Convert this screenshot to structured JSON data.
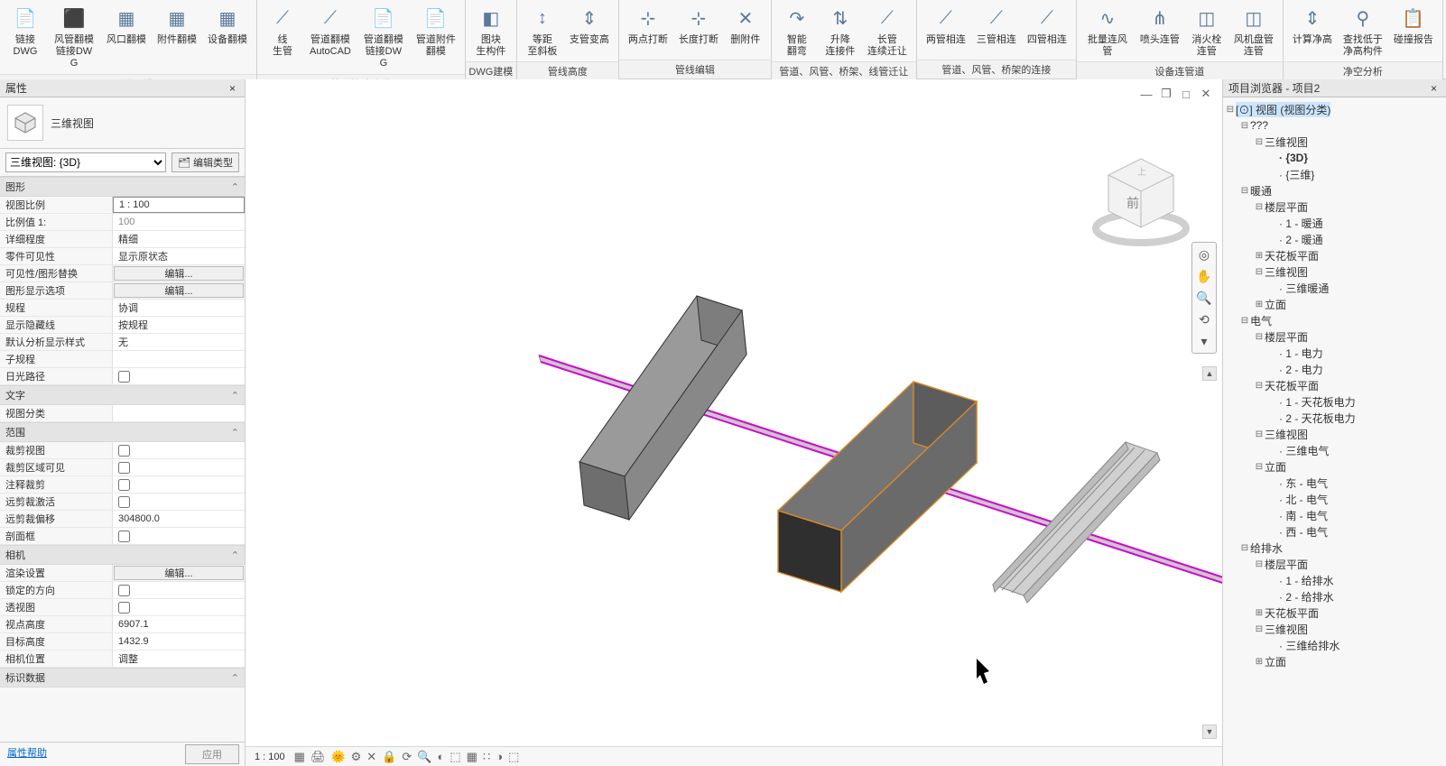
{
  "ribbon": {
    "groups": [
      {
        "title": "风系统翻模",
        "buttons": [
          {
            "label": "链接\nDWG",
            "icon": "📄"
          },
          {
            "label": "风管翻模\n链接DWG",
            "icon": "⬛"
          },
          {
            "label": "风口翻模",
            "icon": "▦"
          },
          {
            "label": "附件翻模",
            "icon": "▦"
          },
          {
            "label": "设备翻模",
            "icon": "▦"
          }
        ]
      },
      {
        "title": "管道快速建模",
        "buttons": [
          {
            "label": "线\n生管",
            "icon": "⟋"
          },
          {
            "label": "管道翻模\nAutoCAD",
            "icon": "⟋"
          },
          {
            "label": "管道翻模\n链接DWG",
            "icon": "📄"
          },
          {
            "label": "管道附件\n翻模",
            "icon": "📄"
          }
        ]
      },
      {
        "title": "DWG建模",
        "buttons": [
          {
            "label": "图块\n生构件",
            "icon": "◧"
          }
        ]
      },
      {
        "title": "管线高度",
        "buttons": [
          {
            "label": "等距\n至斜板",
            "icon": "↕"
          },
          {
            "label": "支管变高",
            "icon": "⇕"
          }
        ]
      },
      {
        "title": "管线编辑",
        "buttons": [
          {
            "label": "两点打断",
            "icon": "⊹"
          },
          {
            "label": "长度打断",
            "icon": "⊹"
          },
          {
            "label": "删附件",
            "icon": "✕"
          }
        ]
      },
      {
        "title": "管道、风管、桥架、线管迁让",
        "buttons": [
          {
            "label": "智能\n翻弯",
            "icon": "↷"
          },
          {
            "label": "升降\n连接件",
            "icon": "⇅"
          },
          {
            "label": "长管\n连续迁让",
            "icon": "⟋"
          }
        ]
      },
      {
        "title": "管道、风管、桥架的连接",
        "buttons": [
          {
            "label": "两管相连",
            "icon": "⟋"
          },
          {
            "label": "三管相连",
            "icon": "⟋"
          },
          {
            "label": "四管相连",
            "icon": "⟋"
          }
        ]
      },
      {
        "title": "设备连管道",
        "buttons": [
          {
            "label": "批量连风管",
            "icon": "∿"
          },
          {
            "label": "喷头连管",
            "icon": "⋔"
          },
          {
            "label": "消火栓\n连管",
            "icon": "◫"
          },
          {
            "label": "风机盘管\n连管",
            "icon": "◫"
          }
        ]
      },
      {
        "title": "净空分析",
        "buttons": [
          {
            "label": "计算净高",
            "icon": "⇕"
          },
          {
            "label": "查找低于\n净高构件",
            "icon": "⚲"
          },
          {
            "label": "碰撞报告",
            "icon": "📋"
          }
        ]
      }
    ]
  },
  "properties": {
    "title": "属性",
    "typeLabel": "三维视图",
    "selector": "三维视图: {3D}",
    "editTypeLabel": "编辑类型",
    "groups": [
      {
        "name": "图形",
        "rows": [
          {
            "n": "视图比例",
            "v": "1 : 100",
            "boxed": true
          },
          {
            "n": "比例值 1:",
            "v": "100",
            "grey": true
          },
          {
            "n": "详细程度",
            "v": "精细"
          },
          {
            "n": "零件可见性",
            "v": "显示原状态"
          },
          {
            "n": "可见性/图形替换",
            "v": "编辑...",
            "btn": true
          },
          {
            "n": "图形显示选项",
            "v": "编辑...",
            "btn": true
          },
          {
            "n": "规程",
            "v": "协调"
          },
          {
            "n": "显示隐藏线",
            "v": "按规程"
          },
          {
            "n": "默认分析显示样式",
            "v": "无"
          },
          {
            "n": "子规程",
            "v": ""
          },
          {
            "n": "日光路径",
            "v": "",
            "check": false
          }
        ]
      },
      {
        "name": "文字",
        "rows": [
          {
            "n": "视图分类",
            "v": ""
          }
        ]
      },
      {
        "name": "范围",
        "rows": [
          {
            "n": "裁剪视图",
            "v": "",
            "check": false
          },
          {
            "n": "裁剪区域可见",
            "v": "",
            "check": false
          },
          {
            "n": "注释裁剪",
            "v": "",
            "check": false
          },
          {
            "n": "远剪裁激活",
            "v": "",
            "check": false
          },
          {
            "n": "远剪裁偏移",
            "v": "304800.0"
          },
          {
            "n": "剖面框",
            "v": "",
            "check": false
          }
        ]
      },
      {
        "name": "相机",
        "rows": [
          {
            "n": "渲染设置",
            "v": "编辑...",
            "btn": true
          },
          {
            "n": "锁定的方向",
            "v": "",
            "check": false
          },
          {
            "n": "透视图",
            "v": "",
            "check": false
          },
          {
            "n": "视点高度",
            "v": "6907.1"
          },
          {
            "n": "目标高度",
            "v": "1432.9"
          },
          {
            "n": "相机位置",
            "v": "调整"
          }
        ]
      },
      {
        "name": "标识数据",
        "rows": []
      }
    ],
    "helpLink": "属性帮助",
    "applyLabel": "应用"
  },
  "browser": {
    "title": "项目浏览器 - 项目2",
    "tree": [
      {
        "depth": 0,
        "toggle": "-",
        "label": "视图 (视图分类)",
        "highlight": true,
        "icon": "[⊙]"
      },
      {
        "depth": 1,
        "toggle": "-",
        "label": "???"
      },
      {
        "depth": 2,
        "toggle": "-",
        "label": "三维视图"
      },
      {
        "depth": 3,
        "toggle": "",
        "label": "{3D}",
        "bold": true
      },
      {
        "depth": 3,
        "toggle": "",
        "label": "{三维}"
      },
      {
        "depth": 1,
        "toggle": "-",
        "label": "暖通"
      },
      {
        "depth": 2,
        "toggle": "-",
        "label": "楼层平面"
      },
      {
        "depth": 3,
        "toggle": "",
        "label": "1 - 暖通"
      },
      {
        "depth": 3,
        "toggle": "",
        "label": "2 - 暖通"
      },
      {
        "depth": 2,
        "toggle": "+",
        "label": "天花板平面"
      },
      {
        "depth": 2,
        "toggle": "-",
        "label": "三维视图"
      },
      {
        "depth": 3,
        "toggle": "",
        "label": "三维暖通"
      },
      {
        "depth": 2,
        "toggle": "+",
        "label": "立面"
      },
      {
        "depth": 1,
        "toggle": "-",
        "label": "电气"
      },
      {
        "depth": 2,
        "toggle": "-",
        "label": "楼层平面"
      },
      {
        "depth": 3,
        "toggle": "",
        "label": "1 - 电力"
      },
      {
        "depth": 3,
        "toggle": "",
        "label": "2 - 电力"
      },
      {
        "depth": 2,
        "toggle": "-",
        "label": "天花板平面"
      },
      {
        "depth": 3,
        "toggle": "",
        "label": "1 - 天花板电力"
      },
      {
        "depth": 3,
        "toggle": "",
        "label": "2 - 天花板电力"
      },
      {
        "depth": 2,
        "toggle": "-",
        "label": "三维视图"
      },
      {
        "depth": 3,
        "toggle": "",
        "label": "三维电气"
      },
      {
        "depth": 2,
        "toggle": "-",
        "label": "立面"
      },
      {
        "depth": 3,
        "toggle": "",
        "label": "东 - 电气"
      },
      {
        "depth": 3,
        "toggle": "",
        "label": "北 - 电气"
      },
      {
        "depth": 3,
        "toggle": "",
        "label": "南 - 电气"
      },
      {
        "depth": 3,
        "toggle": "",
        "label": "西 - 电气"
      },
      {
        "depth": 1,
        "toggle": "-",
        "label": "给排水"
      },
      {
        "depth": 2,
        "toggle": "-",
        "label": "楼层平面"
      },
      {
        "depth": 3,
        "toggle": "",
        "label": "1 - 给排水"
      },
      {
        "depth": 3,
        "toggle": "",
        "label": "2 - 给排水"
      },
      {
        "depth": 2,
        "toggle": "+",
        "label": "天花板平面"
      },
      {
        "depth": 2,
        "toggle": "-",
        "label": "三维视图"
      },
      {
        "depth": 3,
        "toggle": "",
        "label": "三维给排水"
      },
      {
        "depth": 2,
        "toggle": "+",
        "label": "立面"
      }
    ]
  },
  "statusbar": {
    "scale": "1 : 100",
    "icons": [
      "▦",
      "🖨",
      "🌞",
      "⚙",
      "✕",
      "🔒",
      "⟳",
      "🔍",
      "◐",
      "⬚",
      "▦",
      "∷",
      "◑",
      "⬚"
    ]
  },
  "viewcube": {
    "front": "前"
  }
}
